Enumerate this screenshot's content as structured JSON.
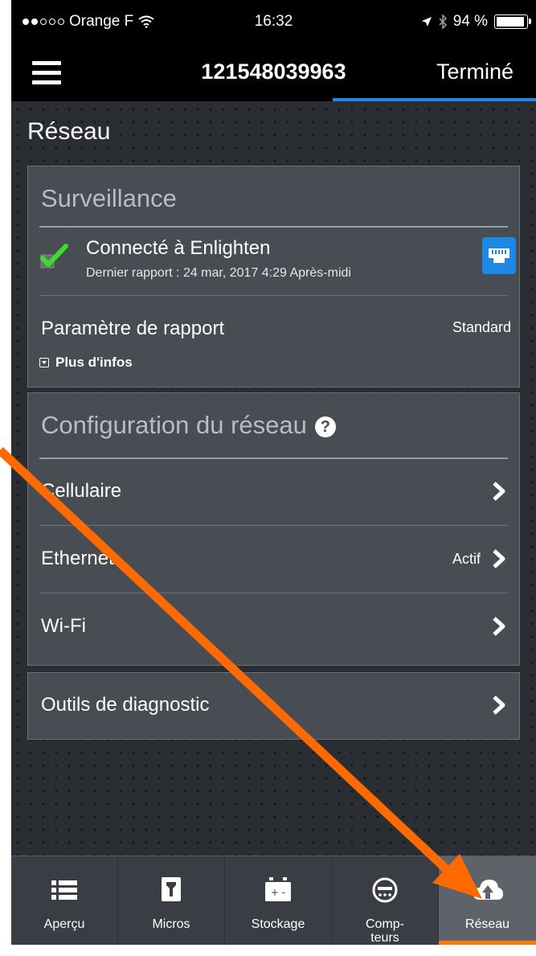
{
  "status_bar": {
    "carrier": "Orange F",
    "time": "16:32",
    "battery": "94 %"
  },
  "nav": {
    "title": "121548039963",
    "done_label": "Terminé"
  },
  "page": {
    "title": "Réseau"
  },
  "surveillance": {
    "header": "Surveillance",
    "connected_title": "Connecté à Enlighten",
    "connected_subtitle": "Dernier rapport : 24 mar, 2017 4:29 Après-midi",
    "report_label": "Paramètre de rapport",
    "report_value": "Standard",
    "more_info": "Plus d'infos"
  },
  "network_config": {
    "header": "Configuration du réseau",
    "help_symbol": "?",
    "rows": [
      {
        "label": "Cellulaire",
        "value": ""
      },
      {
        "label": "Ethernet",
        "value": "Actif"
      },
      {
        "label": "Wi-Fi",
        "value": ""
      }
    ]
  },
  "diagnostics": {
    "label": "Outils de diagnostic"
  },
  "tabs": [
    {
      "label": "Aperçu",
      "icon": "list-icon"
    },
    {
      "label": "Micros",
      "icon": "microinverter-icon"
    },
    {
      "label": "Stockage",
      "icon": "battery-storage-icon"
    },
    {
      "label": "Comp-\nteurs",
      "icon": "meter-icon"
    },
    {
      "label": "Réseau",
      "icon": "cloud-upload-icon"
    }
  ],
  "colors": {
    "accent_blue": "#1e88e5",
    "active_tab_orange": "#ff7a00",
    "check_green": "#3ddc2f",
    "annotation_arrow": "#ff6a00"
  }
}
